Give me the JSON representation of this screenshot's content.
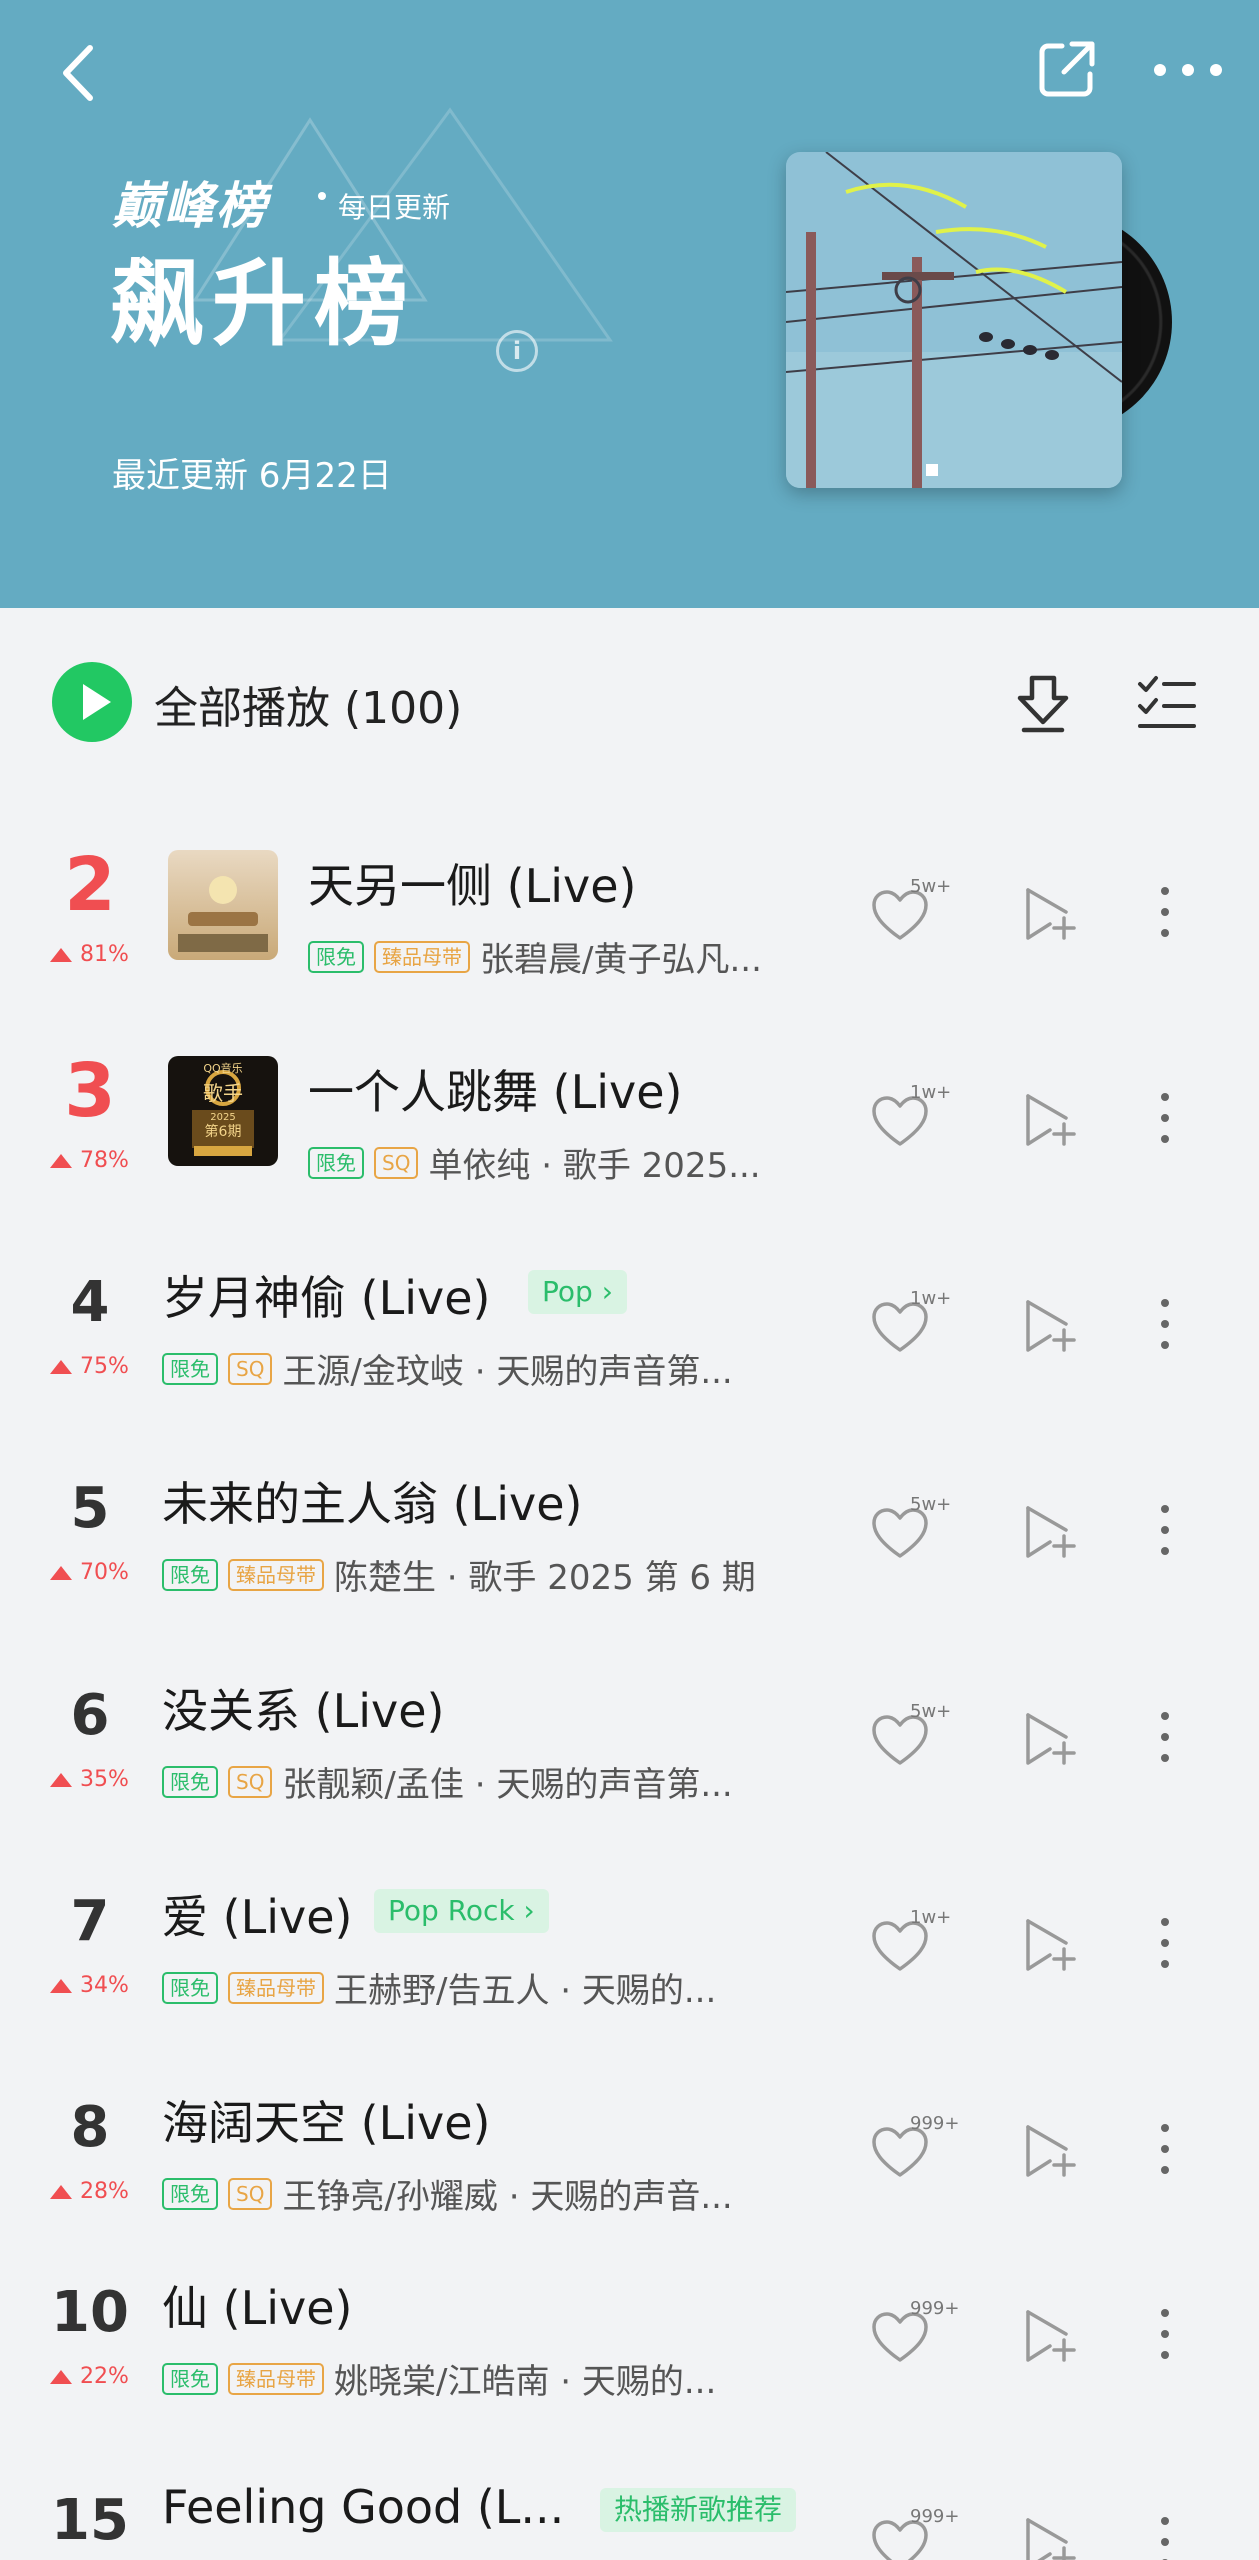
{
  "header": {
    "brand": "巅峰榜",
    "brand_sub": "每日更新",
    "title": "飙升榜",
    "updated": "最近更新 6月22日",
    "bg_color": "#64abc2"
  },
  "toolbar": {
    "play_all_label": "全部播放 (100)",
    "play_color": "#22c863"
  },
  "songs": [
    {
      "rank": "2",
      "trend": "81%",
      "title": "天另一侧 (Live)",
      "genre": "",
      "badges": [
        "限免",
        "臻品母带"
      ],
      "artist": "张碧晨/黄子弘凡...",
      "likes": "5w+"
    },
    {
      "rank": "3",
      "trend": "78%",
      "title": "一个人跳舞 (Live)",
      "genre": "",
      "badges": [
        "限免",
        "SQ"
      ],
      "artist": "单依纯 · 歌手 2025...",
      "likes": "1w+"
    },
    {
      "rank": "4",
      "trend": "75%",
      "title": "岁月神偷 (Live)",
      "genre": "Pop",
      "badges": [
        "限免",
        "SQ"
      ],
      "artist": "王源/金玟岐 · 天赐的声音第...",
      "likes": "1w+"
    },
    {
      "rank": "5",
      "trend": "70%",
      "title": "未来的主人翁 (Live)",
      "genre": "",
      "badges": [
        "限免",
        "臻品母带"
      ],
      "artist": "陈楚生 · 歌手 2025 第 6 期",
      "likes": "5w+"
    },
    {
      "rank": "6",
      "trend": "35%",
      "title": "没关系 (Live)",
      "genre": "",
      "badges": [
        "限免",
        "SQ"
      ],
      "artist": "张靓颖/孟佳 · 天赐的声音第...",
      "likes": "5w+"
    },
    {
      "rank": "7",
      "trend": "34%",
      "title": "爱 (Live)",
      "genre": "Pop Rock",
      "badges": [
        "限免",
        "臻品母带"
      ],
      "artist": "王赫野/告五人 · 天赐的...",
      "likes": "1w+"
    },
    {
      "rank": "8",
      "trend": "28%",
      "title": "海阔天空 (Live)",
      "genre": "",
      "badges": [
        "限免",
        "SQ"
      ],
      "artist": "王铮亮/孙耀威 · 天赐的声音...",
      "likes": "999+"
    },
    {
      "rank": "10",
      "trend": "22%",
      "title": "仙 (Live)",
      "genre": "",
      "badges": [
        "限免",
        "臻品母带"
      ],
      "artist": "姚晓棠/江皓南 · 天赐的...",
      "likes": "999+"
    },
    {
      "rank": "15",
      "trend": "",
      "title": "Feeling Good (L...",
      "genre": "热播新歌推荐",
      "badges": [],
      "artist": "",
      "likes": "999+"
    }
  ],
  "art_labels": {
    "qq": "QQ音乐",
    "singer": "歌手",
    "year": "2025",
    "episode": "第6期"
  }
}
